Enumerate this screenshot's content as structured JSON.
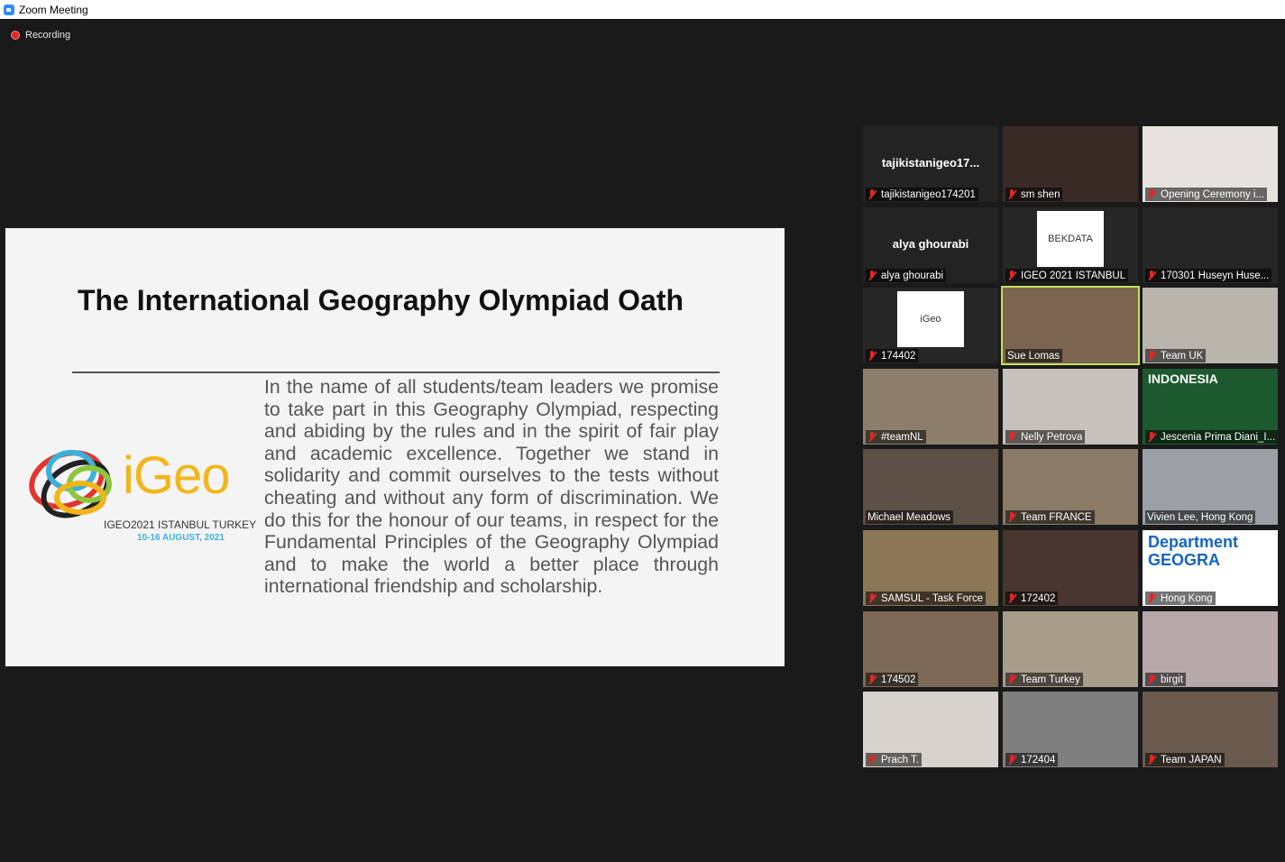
{
  "window": {
    "title": "Zoom Meeting"
  },
  "recording": {
    "label": "Recording"
  },
  "slide": {
    "heading": "The International Geography Olympiad Oath",
    "oath": "In the name of all students/team leaders we promise to take part in this Geography Olympiad, respecting and abiding by the rules and in the spirit of fair play and academic excellence. Together we stand in solidarity and commit ourselves to the tests without cheating and without any form of discrimination. We do this for the honour of our teams, in respect for the Fundamental Principles of the Geography Olympiad and to make the world a better place through international friendship and scholarship.",
    "logo_word": "iGeo",
    "logo_sub1": "IGEO2021 ISTANBUL TURKEY",
    "logo_sub2": "10-16 AUGUST, 2021"
  },
  "participants": [
    {
      "name": "tajikistanigeo174201",
      "center_name": "tajikistanigeo17...",
      "video": false,
      "muted": true
    },
    {
      "name": "sm shen",
      "video": true,
      "muted": true,
      "bg": "#3a2a26"
    },
    {
      "name": "Opening Ceremony i...",
      "video": true,
      "muted": true,
      "bg": "#e7e3de"
    },
    {
      "name": "alya ghourabi",
      "center_name": "alya ghourabi",
      "video": false,
      "muted": true
    },
    {
      "name": "IGEO 2021 ISTANBUL",
      "video": true,
      "muted": true,
      "bg": "#262626",
      "logo_text": "BEKDATA"
    },
    {
      "name": "170301 Huseyn Huse...",
      "video": true,
      "muted": true,
      "bg": "#262626"
    },
    {
      "name": "174402",
      "video": true,
      "muted": true,
      "bg": "#262626",
      "logo_text": "iGeo"
    },
    {
      "name": "Sue Lomas",
      "video": true,
      "muted": false,
      "active": true,
      "bg": "#7a6650"
    },
    {
      "name": "Team UK",
      "video": true,
      "muted": true,
      "bg": "#b9b5ad"
    },
    {
      "name": "#teamNL",
      "video": true,
      "muted": true,
      "bg": "#8d7e6c"
    },
    {
      "name": "Nelly Petrova",
      "video": true,
      "muted": true,
      "bg": "#c8c0bb"
    },
    {
      "name": "Jescenia Prima Diani_I...",
      "video": true,
      "muted": true,
      "bg": "#1e5a2f",
      "banner": "INDONESIA"
    },
    {
      "name": "Michael Meadows",
      "video": true,
      "muted": false,
      "bg": "#5d5045"
    },
    {
      "name": "Team FRANCE",
      "video": true,
      "muted": true,
      "bg": "#8a7a66"
    },
    {
      "name": "Vivien Lee, Hong Kong",
      "video": true,
      "muted": false,
      "bg": "#9aa0a6"
    },
    {
      "name": "SAMSUL - Task Force",
      "video": true,
      "muted": true,
      "bg": "#8b7656"
    },
    {
      "name": "172402",
      "video": true,
      "muted": true,
      "bg": "#4a3630"
    },
    {
      "name": "Hong Kong",
      "video": true,
      "muted": true,
      "bg": "#ffffff",
      "banner": "Department GEOGRA"
    },
    {
      "name": "174502",
      "video": true,
      "muted": true,
      "bg": "#7c6a57"
    },
    {
      "name": "Team Turkey",
      "video": true,
      "muted": true,
      "bg": "#a89c8a"
    },
    {
      "name": "birgit",
      "video": true,
      "muted": true,
      "bg": "#b7a8aa"
    },
    {
      "name": "Prach T.",
      "video": true,
      "muted": true,
      "bg": "#d6d2cc"
    },
    {
      "name": "172404",
      "video": true,
      "muted": true,
      "bg": "#7f7f80"
    },
    {
      "name": "Team JAPAN",
      "video": true,
      "muted": true,
      "bg": "#6b5b4e"
    }
  ],
  "colors": {
    "accent": "#2d8cff",
    "mute": "#e02828",
    "active_speaker": "#c6e05a"
  }
}
